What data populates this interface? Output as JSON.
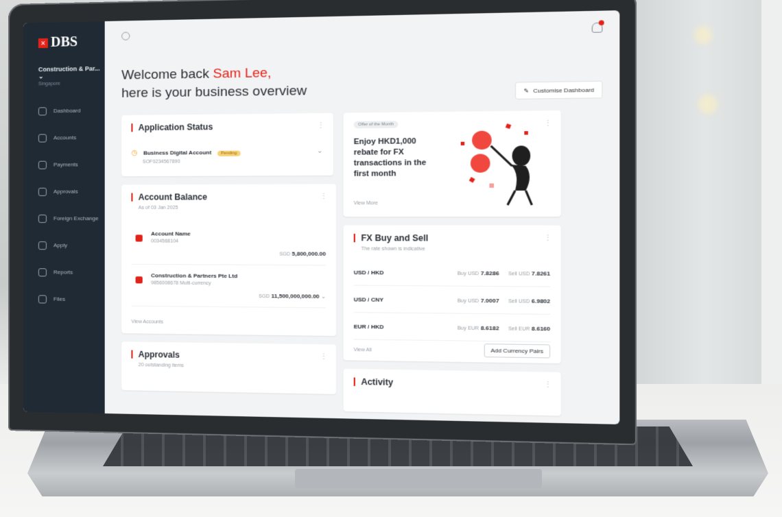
{
  "app": {
    "brand": "DBS",
    "brand_mark": "×"
  },
  "sidebar": {
    "company": "Construction & Par...",
    "company_sub": "Singapore",
    "items": [
      {
        "label": "Dashboard",
        "icon": "home-icon"
      },
      {
        "label": "Accounts",
        "icon": "accounts-icon"
      },
      {
        "label": "Payments",
        "icon": "payments-icon"
      },
      {
        "label": "Approvals",
        "icon": "approvals-icon"
      },
      {
        "label": "Foreign Exchange",
        "icon": "exchange-icon"
      },
      {
        "label": "Apply",
        "icon": "apply-icon"
      },
      {
        "label": "Reports",
        "icon": "reports-icon"
      },
      {
        "label": "Files",
        "icon": "files-icon"
      }
    ]
  },
  "header": {
    "welcome": "Welcome back",
    "user": "Sam Lee,",
    "subtitle": "here is your business overview",
    "customise": "Customise Dashboard"
  },
  "application_status": {
    "title": "Application Status",
    "account": "Business Digital Account",
    "tag": "Pending",
    "ref": "SOF0234567890"
  },
  "account_balance": {
    "title": "Account Balance",
    "as_of": "As of 03 Jan 2025",
    "accounts": [
      {
        "name": "Account Name",
        "number": "0034568104",
        "currency": "SGD",
        "amount": "5,800,000.00"
      },
      {
        "name": "Construction & Partners Pte Ltd",
        "number": "9856008678 Multi-currency",
        "currency": "SGD",
        "amount": "11,500,000,000.00"
      }
    ],
    "link": "View Accounts"
  },
  "approvals": {
    "title": "Approvals",
    "sub": "20 outstanding items"
  },
  "offer": {
    "badge": "Offer of the Month",
    "text": "Enjoy HKD1,000 rebate for FX transactions in the first month",
    "link": "View More"
  },
  "fx": {
    "title": "FX Buy and Sell",
    "note": "The rate shown is indicative",
    "pairs": [
      {
        "pair": "USD / HKD",
        "buy_label": "Buy USD",
        "buy": "7.8286",
        "sell_label": "Sell USD",
        "sell": "7.8261"
      },
      {
        "pair": "USD / CNY",
        "buy_label": "Buy USD",
        "buy": "7.0007",
        "sell_label": "Sell USD",
        "sell": "6.9802"
      },
      {
        "pair": "EUR / HKD",
        "buy_label": "Buy EUR",
        "buy": "8.6182",
        "sell_label": "Sell EUR",
        "sell": "8.6160"
      }
    ],
    "view_all": "View All",
    "add_button": "Add Currency Pairs"
  },
  "activity": {
    "title": "Activity"
  },
  "colors": {
    "brand_red": "#e2231a",
    "sidebar_bg": "#1f2a35",
    "pending_tag": "#f7d27a"
  }
}
